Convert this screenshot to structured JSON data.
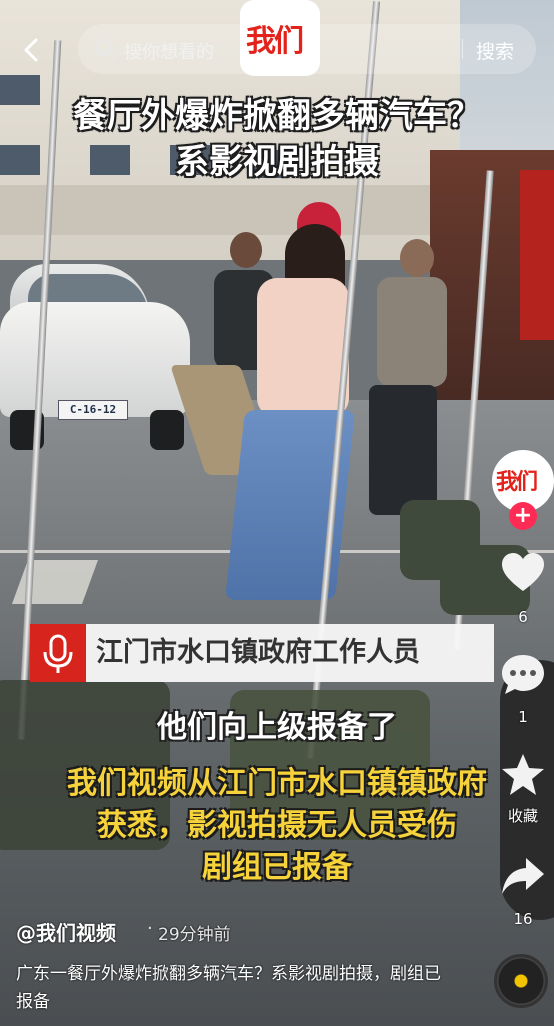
{
  "search": {
    "placeholder": "搜你想看的",
    "button_label": "搜索"
  },
  "top_logo": {
    "text": "我们"
  },
  "headline": {
    "line1": "餐厅外爆炸掀翻多辆汽车？",
    "line2": "系影视剧拍摄"
  },
  "scene": {
    "car_plate": "C-16-12"
  },
  "lower_third": {
    "speaker": "江门市水口镇政府工作人员",
    "quote": "他们向上级报备了"
  },
  "caption": {
    "line1": "我们视频从江门市水口镇镇政府",
    "line2": "获悉，影视拍摄无人员受伤",
    "line3": "剧组已报备"
  },
  "rail": {
    "avatar_text": "我们",
    "follow_symbol": "+",
    "like_count": "6",
    "comment_count": "1",
    "favorite_label": "收藏",
    "share_count": "16"
  },
  "post": {
    "author": "@我们视频",
    "separator": "·",
    "time": "29分钟前",
    "description": "广东一餐厅外爆炸掀翻多辆汽车？系影视剧拍摄，剧组已报备"
  },
  "colors": {
    "brand_red": "#e3231b",
    "follow_pink": "#fe2c55",
    "caption_yellow": "#f6d33a"
  }
}
